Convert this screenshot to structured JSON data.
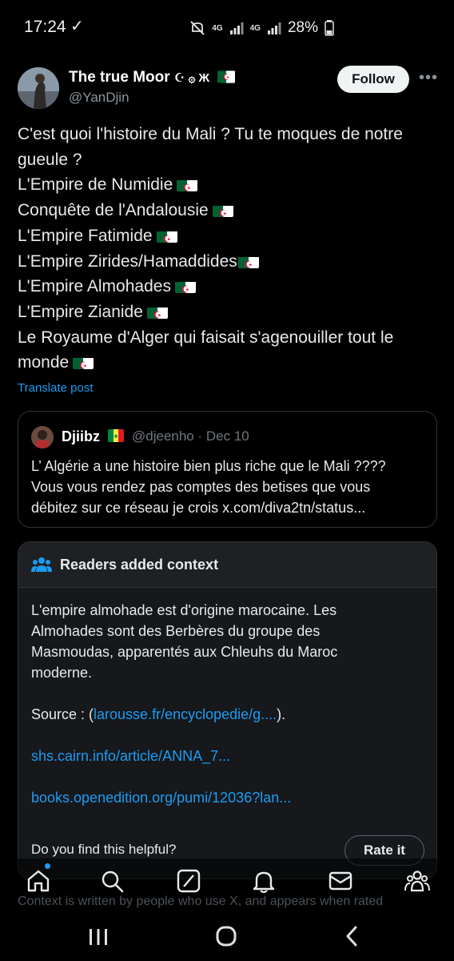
{
  "status_bar": {
    "time": "17:24",
    "network_1": "4G",
    "network_2": "4G",
    "battery": "28%"
  },
  "post": {
    "author_name": "The true Moor",
    "author_suffix": "☪ ۞ Ж",
    "author_handle": "@YanDjin",
    "follow_label": "Follow",
    "more_icon": "more-horizontal-icon",
    "lines": [
      "C'est quoi l'histoire du Mali ? Tu te moques de notre",
      "gueule ?",
      "L'Empire de Numidie",
      "Conquête de l'Andalousie",
      "L'Empire Fatimide",
      "L'Empire Zirides/Hamaddides",
      "L'Empire Almohades",
      "L'Empire Zianide",
      "Le Royaume d'Alger qui faisait s'agenouiller tout le",
      "monde"
    ],
    "translate_label": "Translate post"
  },
  "quote": {
    "name": "Djiibz",
    "handle_date": "@djeenho · Dec 10",
    "text_lines": [
      "L’ Algérie a une histoire bien plus riche que le Mali ????",
      "Vous vous rendez pas comptes des betises que vous",
      "débitez sur ce réseau je crois x.com/diva2tn/status..."
    ]
  },
  "note": {
    "title": "Readers added context",
    "lines": [
      "L'empire almohade est d'origine marocaine. Les",
      "Almohades sont des Berbères du groupe des",
      "Masmoudas, apparentés aux Chleuhs du Maroc",
      "moderne."
    ],
    "source_prefix": "Source :  (",
    "source_link": "larousse.fr/encyclopedie/g....",
    "source_suffix": ").",
    "link_2": "shs.cairn.info/article/ANNA_7...",
    "link_3": "books.openedition.org/pumi/12036?lan...",
    "helpful_question": "Do you find this helpful?",
    "rate_label": "Rate it"
  },
  "footer_text": "Context is written by people who use X, and appears when rated",
  "colors": {
    "accent": "#1d9bf0",
    "background": "#000000",
    "card_border": "#2f3336"
  }
}
